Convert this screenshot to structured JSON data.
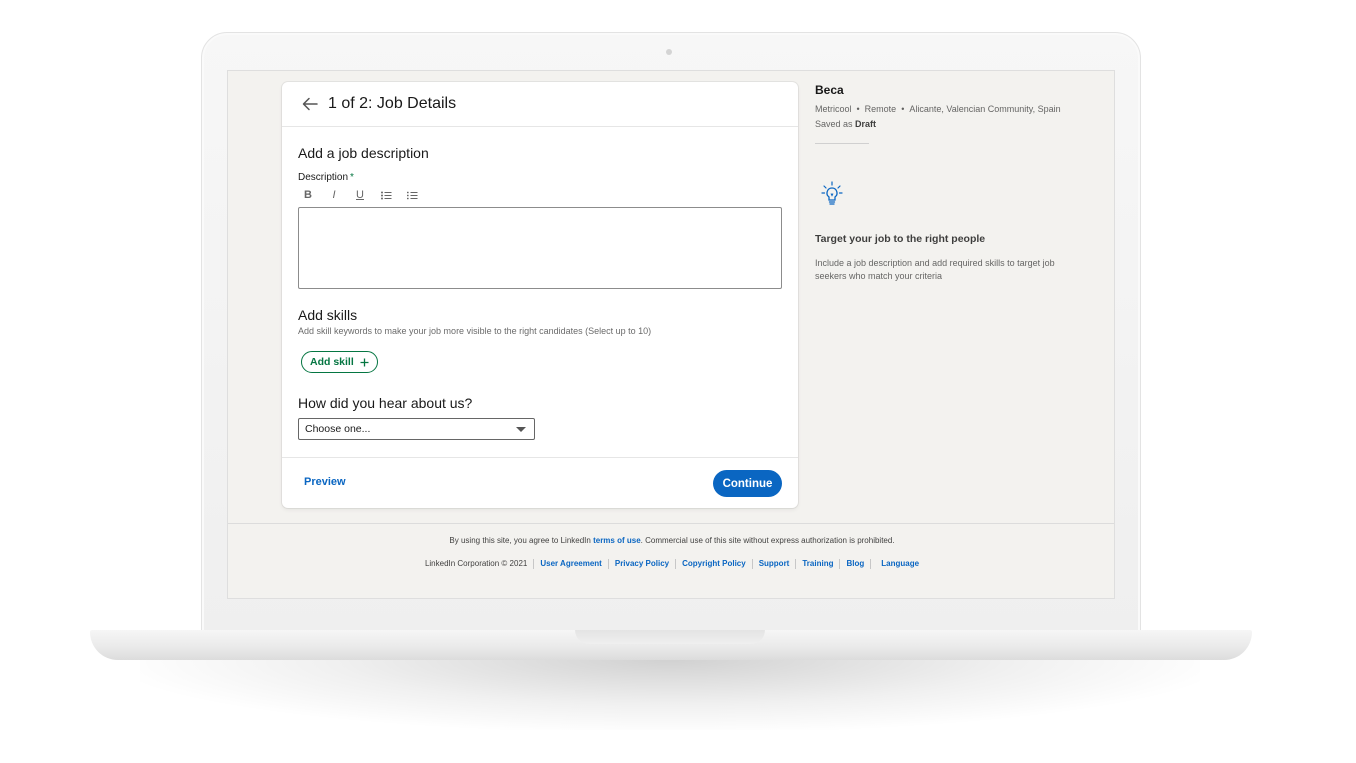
{
  "card": {
    "title": "1 of 2: Job Details",
    "description_section": "Add a job description",
    "description_label": "Description",
    "required_mark": "*",
    "toolbar": [
      "B",
      "I",
      "U"
    ],
    "skills_section": "Add skills",
    "skills_helper": "Add skill keywords to make your job more visible to the right candidates (Select up to 10)",
    "add_skill_label": "Add skill",
    "hear_section": "How did you hear about us?",
    "select_value": "Choose one...",
    "preview_label": "Preview",
    "continue_label": "Continue"
  },
  "aside": {
    "job_title": "Beca",
    "company": "Metricool",
    "workplace": "Remote",
    "location": "Alicante, Valencian Community, Spain",
    "saved_prefix": "Saved as",
    "saved_status": "Draft",
    "tip_title": "Target your job to the right people",
    "tip_text": "Include a job description and add required skills to target job seekers who match your criteria"
  },
  "footer": {
    "terms_prefix": "By using this site, you agree to LinkedIn",
    "terms_link": "terms of use",
    "terms_suffix": ". Commercial use of this site without express authorization is prohibited.",
    "copyright": "LinkedIn Corporation © 2021",
    "links": [
      "User Agreement",
      "Privacy Policy",
      "Copyright Policy",
      "Support",
      "Training",
      "Blog",
      "Language"
    ]
  },
  "colors": {
    "primary": "#0a66c2",
    "green": "#057642",
    "page_bg": "#f3f2ef"
  },
  "icons": {
    "back": "arrow-left-icon",
    "bold": "bold-icon",
    "italic": "italic-icon",
    "underline": "underline-icon",
    "bullet_list": "bullet-list-icon",
    "numbered_list": "numbered-list-icon",
    "plus": "plus-icon",
    "caret": "chevron-down-icon",
    "tip": "lightbulb-icon"
  }
}
